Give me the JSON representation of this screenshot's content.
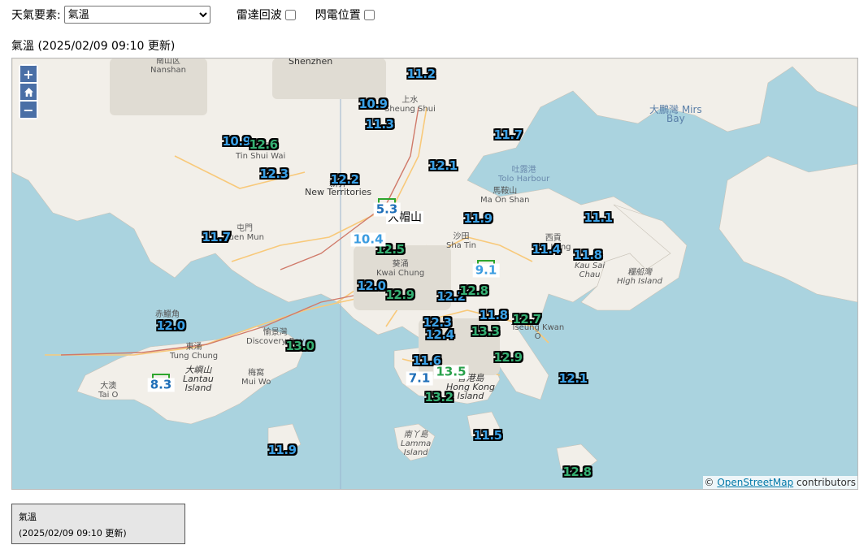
{
  "toolbar": {
    "element_label": "天氣要素:",
    "element_selected": "氣溫",
    "radar_label": "雷達回波",
    "lightning_label": "閃電位置"
  },
  "map_title": "氣溫 (2025/02/09 09:10 更新)",
  "zoom": {
    "in": "+",
    "home": "⌂",
    "out": "−"
  },
  "place_labels": {
    "nanshan": "南山区\nNanshan",
    "shenzhen": "Shenzhen",
    "sheung_shui": "上水\nSheung Shui",
    "tin_shui_wai": "天水圍\nTin Shui Wai",
    "new_territories": "新界\nNew Territories",
    "tolo_harbour": "吐露港\nTolo Harbour",
    "ma_on_shan": "馬鞍山\nMa On Shan",
    "sha_tin": "沙田\nSha Tin",
    "kwai_chung": "葵涌\nKwai Chung",
    "tuen_mun": "屯門\nTuen Mun",
    "sai_kung": "西貢\nSai Kung",
    "kau_sai_chau": "Kau Sai\nChau",
    "high_island": "糧船灣\nHigh Island",
    "mirs_bay": "大鵬灣 Mirs\nBay",
    "chek_lap_kok": "赤鱲角",
    "tung_chung": "東涌\nTung Chung",
    "discovery_bay": "愉景灣\nDiscovery Bay",
    "lantau": "大嶼山\nLantau\nIsland",
    "tai_o": "大澳\nTai O",
    "mui_wo": "梅窩\nMui Wo",
    "hong_kong_island": "香港島\nHong Kong\nIsland",
    "lamma": "南丫島\nLamma\nIsland",
    "tseung_kwan_o": "Tseung Kwan\nO"
  },
  "peak_label": "大帽山",
  "stations": [
    {
      "v": "11.2",
      "c": "blue"
    },
    {
      "v": "10.9",
      "c": "blue"
    },
    {
      "v": "11.3",
      "c": "blue"
    },
    {
      "v": "11.7",
      "c": "blue"
    },
    {
      "v": "10.9",
      "c": "blue"
    },
    {
      "v": "12.6",
      "c": "green"
    },
    {
      "v": "12.3",
      "c": "blue"
    },
    {
      "v": "12.2",
      "c": "blue"
    },
    {
      "v": "12.1",
      "c": "blue"
    },
    {
      "v": "11.9",
      "c": "blue"
    },
    {
      "v": "11.1",
      "c": "blue"
    },
    {
      "v": "11.7",
      "c": "blue"
    },
    {
      "v": "12.5",
      "c": "green"
    },
    {
      "v": "11.4",
      "c": "blue"
    },
    {
      "v": "11.8",
      "c": "blue"
    },
    {
      "v": "12.0",
      "c": "blue"
    },
    {
      "v": "12.9",
      "c": "green"
    },
    {
      "v": "12.2",
      "c": "blue"
    },
    {
      "v": "12.8",
      "c": "green"
    },
    {
      "v": "11.8",
      "c": "blue"
    },
    {
      "v": "12.7",
      "c": "green"
    },
    {
      "v": "12.0",
      "c": "blue"
    },
    {
      "v": "12.3",
      "c": "blue"
    },
    {
      "v": "12.4",
      "c": "blue"
    },
    {
      "v": "13.3",
      "c": "green"
    },
    {
      "v": "13.0",
      "c": "green"
    },
    {
      "v": "12.9",
      "c": "green"
    },
    {
      "v": "11.6",
      "c": "blue"
    },
    {
      "v": "12.1",
      "c": "blue"
    },
    {
      "v": "13.2",
      "c": "green"
    },
    {
      "v": "11.5",
      "c": "blue"
    },
    {
      "v": "11.9",
      "c": "blue"
    },
    {
      "v": "12.8",
      "c": "green"
    }
  ],
  "plain_readings": [
    {
      "v": "5.3",
      "c": "b1"
    },
    {
      "v": "10.4",
      "c": "b2"
    },
    {
      "v": "9.1",
      "c": "b2"
    },
    {
      "v": "8.3",
      "c": "b1"
    },
    {
      "v": "7.1",
      "c": "b1"
    },
    {
      "v": "13.5",
      "c": "g1"
    }
  ],
  "attribution": {
    "prefix": "© ",
    "link": "OpenStreetMap",
    "suffix": " contributors"
  },
  "legend": {
    "line1": "氣溫",
    "line2": "(2025/02/09 09:10 更新)"
  },
  "colors": {
    "sea": "#aad3df",
    "land": "#f2efe9",
    "blue_reading": "#3aa0e6",
    "green_reading": "#35b073",
    "zoom_button": "#4a6fa6"
  }
}
